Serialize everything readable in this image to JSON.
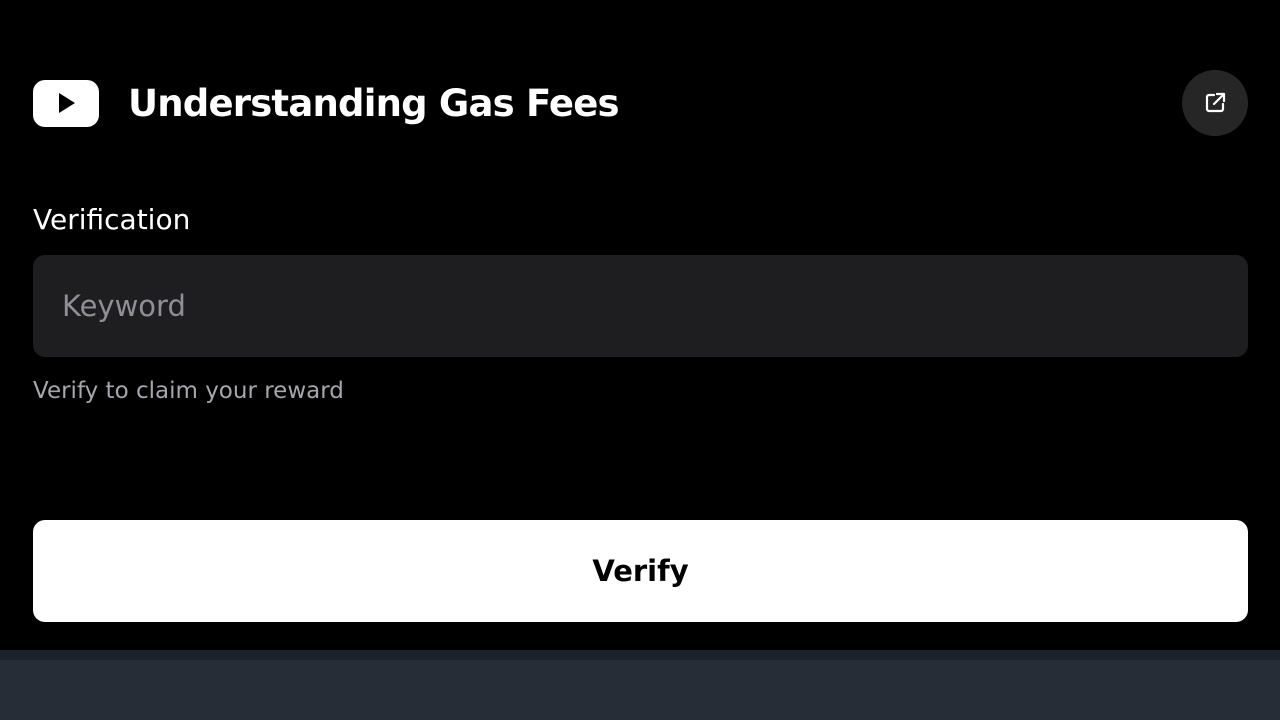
{
  "header": {
    "title": "Understanding Gas Fees",
    "logo_icon": "youtube-play-icon",
    "external_link_icon": "external-link-icon"
  },
  "verification": {
    "label": "Verification",
    "input_placeholder": "Keyword",
    "input_value": "",
    "helper_text": "Verify to claim your reward",
    "button_label": "Verify"
  },
  "colors": {
    "background": "#000000",
    "input_background": "#1e1e20",
    "button_background": "#ffffff",
    "icon_button_background": "#262626",
    "bottom_bar": "#272d36"
  }
}
